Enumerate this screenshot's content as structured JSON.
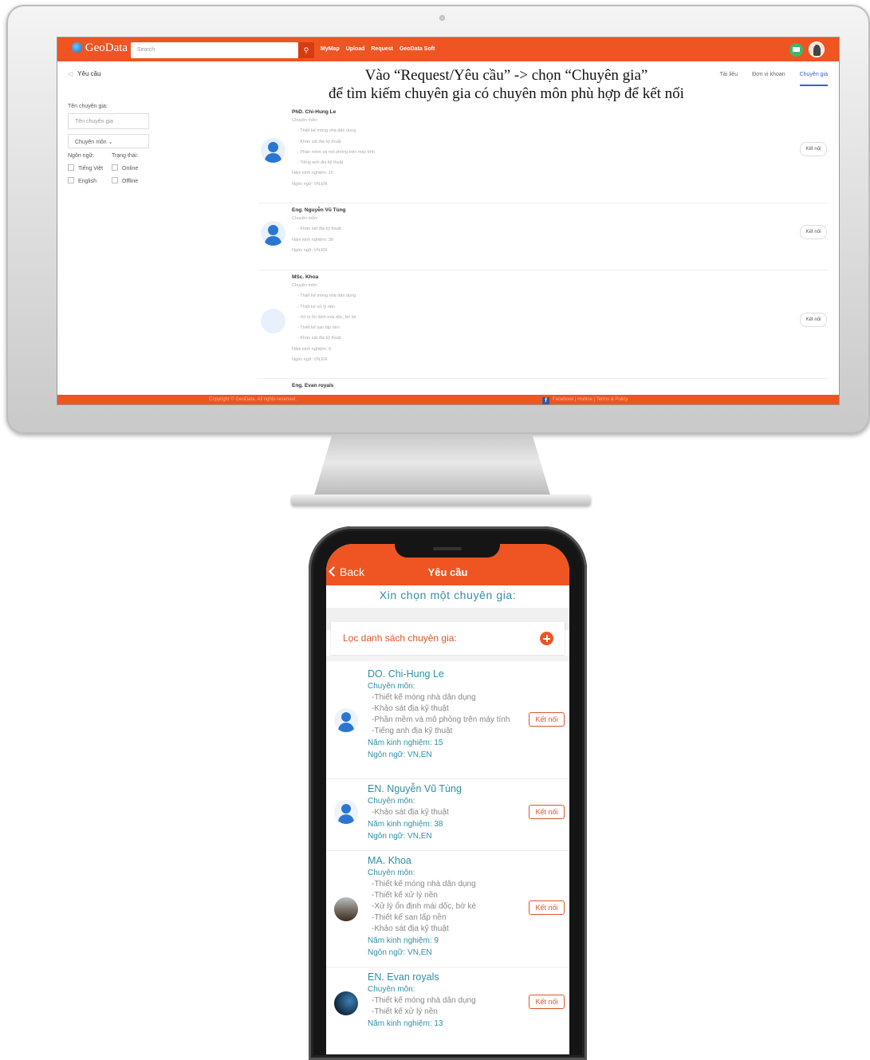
{
  "desktop": {
    "logo": "GeoData",
    "search_placeholder": "Search",
    "nav": [
      "MyMap",
      "Upload",
      "Request",
      "GeoData Soft"
    ],
    "breadcrumb": "Yêu cầu",
    "tabs": [
      "Tài liệu",
      "Đơn vị khoan",
      "Chuyên gia"
    ],
    "active_tab": "Chuyên gia",
    "instruction_line1": "Vào “Request/Yêu cầu” -> chọn “Chuyên gia”",
    "instruction_line2": "để tìm kiếm chuyên gia có chuyên môn phù hợp để kết nối",
    "filter": {
      "name_label": "Tên chuyên gia:",
      "name_placeholder": "Tên chuyên gia",
      "specialty_select": "Chuyên môn",
      "language_label": "Ngôn ngữ:",
      "status_label": "Trạng thái:",
      "options": [
        "Tiếng Việt",
        "Online",
        "English",
        "Offline"
      ]
    },
    "experts": [
      {
        "name": "PhD. Chi-Hung Le",
        "specialty_label": "Chuyên môn:",
        "skills": [
          "- Thiết kế móng nhà dân dụng",
          "- Khảo sát địa kỹ thuật",
          "- Phần mềm và mô phỏng trên máy tính",
          "- Tiếng anh địa kỹ thuật"
        ],
        "experience": "Năm kinh nghiệm: 15",
        "language": "Ngôn ngữ: VN,EN"
      },
      {
        "name": "Eng. Nguyễn Vũ Tùng",
        "specialty_label": "Chuyên môn:",
        "skills": [
          "- Khảo sát địa kỹ thuật"
        ],
        "experience": "Năm kinh nghiệm: 38",
        "language": "Ngôn ngữ: VN,EN"
      },
      {
        "name": "MSc. Khoa",
        "specialty_label": "Chuyên môn:",
        "skills": [
          "- Thiết kế móng nhà dân dụng",
          "- Thiết kế xử lý nền",
          "- Xử lý ổn định mái dốc, bờ kè",
          "- Thiết kế san lấp nền",
          "- Khảo sát địa kỹ thuật"
        ],
        "experience": "Năm kinh nghiệm: 9",
        "language": "Ngôn ngữ: VN,EN"
      },
      {
        "name": "Eng. Evan royals"
      }
    ],
    "connect_label": "Kết nối",
    "footer_left": "Copyright © GeoData. All rights reserved.",
    "footer_right": "Facebook | Hotline | Terms & Policy"
  },
  "mobile": {
    "back_label": "Back",
    "title": "Yêu cầu",
    "prompt": "Xin chọn một chuyên gia:",
    "filter_label": "Lọc danh sách chuyên gia:",
    "connect_label": "Kết nối",
    "experts": [
      {
        "name": "DO. Chi-Hung Le",
        "specialty_label": "Chuyên môn:",
        "skills": [
          "-Thiết kế móng nhà dân dụng",
          "-Khảo sát địa kỹ thuật",
          "-Phần mềm và mô phỏng trên máy tính",
          "-Tiếng anh địa kỹ thuật"
        ],
        "experience": "Năm kinh nghiệm: 15",
        "language": "Ngôn ngữ: VN,EN"
      },
      {
        "name": "EN. Nguyễn Vũ Tùng",
        "specialty_label": "Chuyên môn:",
        "skills": [
          "-Khảo sát địa kỹ thuật"
        ],
        "experience": "Năm kinh nghiệm: 38",
        "language": "Ngôn ngữ: VN,EN"
      },
      {
        "name": "MA. Khoa",
        "specialty_label": "Chuyên môn:",
        "skills": [
          "-Thiết kế móng nhà dân dụng",
          "-Thiết kế xử lý nền",
          "-Xử lý ổn định mái dốc, bờ kè",
          "-Thiết kế san lấp nền",
          "-Khảo sát địa kỹ thuật"
        ],
        "experience": "Năm kinh nghiệm: 9",
        "language": "Ngôn ngữ: VN,EN"
      },
      {
        "name": "EN. Evan royals",
        "specialty_label": "Chuyên môn:",
        "skills": [
          "-Thiết kế móng nhà dân dụng",
          "-Thiết kế xử lý nền"
        ],
        "experience": "Năm kinh nghiệm: 13"
      }
    ]
  },
  "colors": {
    "accent": "#ee5522",
    "teal_text": "#2f8fa6",
    "tab_active": "#3a5fd9"
  }
}
